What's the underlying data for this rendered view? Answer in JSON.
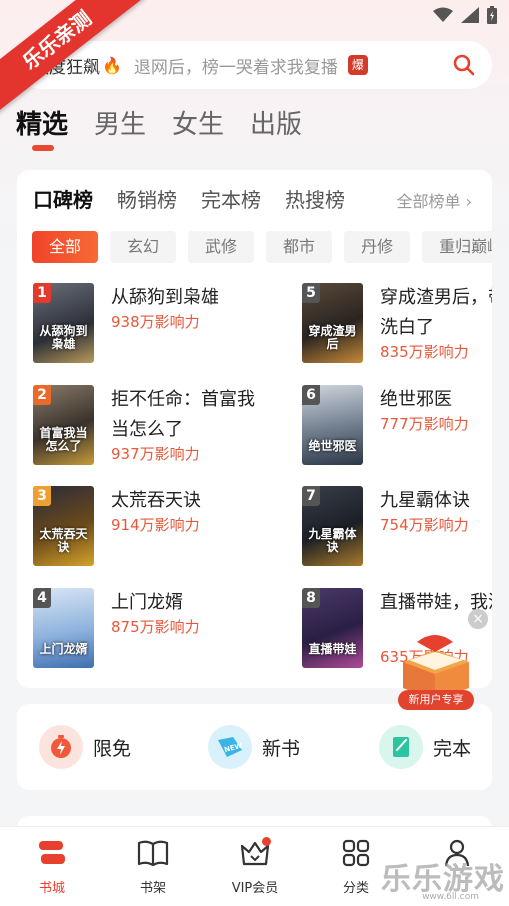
{
  "status_bar": {
    "icons": [
      "notification-icon",
      "a-icon",
      "wifi-icon",
      "signal-icon",
      "battery-icon"
    ]
  },
  "ribbon": {
    "text": "乐乐亲测"
  },
  "search": {
    "hot_label": "热度狂飙",
    "placeholder": "退网后，榜一哭着求我复播",
    "badge": "爆"
  },
  "channel_tabs": [
    {
      "label": "精选",
      "active": true
    },
    {
      "label": "男生",
      "active": false
    },
    {
      "label": "女生",
      "active": false
    },
    {
      "label": "出版",
      "active": false
    }
  ],
  "ranking": {
    "tabs": [
      "口碑榜",
      "畅销榜",
      "完本榜",
      "热搜榜"
    ],
    "active_tab": "口碑榜",
    "all_link": "全部榜单 ›",
    "genres": [
      "全部",
      "玄幻",
      "武修",
      "都市",
      "丹修",
      "重归巅峰"
    ],
    "active_genre": "全部",
    "books": [
      {
        "rank": "1",
        "title": "从舔狗到枭雄",
        "score": "938万影响力",
        "cover_text": "从舔狗到枭雄"
      },
      {
        "rank": "2",
        "title": "拒不任命：首富我当怎么了",
        "score": "937万影响力",
        "cover_text": "首富我当怎么了"
      },
      {
        "rank": "3",
        "title": "太荒吞天诀",
        "score": "914万影响力",
        "cover_text": "太荒吞天诀"
      },
      {
        "rank": "4",
        "title": "上门龙婿",
        "score": "875万影响力",
        "cover_text": "上门龙婿"
      },
      {
        "rank": "5",
        "title": "穿成渣男后，带娃洗白了",
        "score": "835万影响力",
        "cover_text": "穿成渣男后"
      },
      {
        "rank": "6",
        "title": "绝世邪医",
        "score": "777万影响力",
        "cover_text": "绝世邪医"
      },
      {
        "rank": "7",
        "title": "九星霸体诀",
        "score": "754万影响力",
        "cover_text": "九星霸体诀"
      },
      {
        "rank": "8",
        "title": "直播带娃，我流了",
        "score": "635万影响力",
        "cover_text": "直播带娃"
      }
    ]
  },
  "new_user": {
    "label": "新用户专享",
    "close": "×"
  },
  "quick_entries": [
    {
      "label": "限免",
      "icon": "timer-icon"
    },
    {
      "label": "新书",
      "icon": "new-tag-icon"
    },
    {
      "label": "完本",
      "icon": "book-complete-icon"
    }
  ],
  "bottom_nav": [
    {
      "label": "书城",
      "icon": "bookstore-icon",
      "active": true
    },
    {
      "label": "书架",
      "icon": "bookshelf-icon",
      "active": false
    },
    {
      "label": "VIP会员",
      "icon": "vip-crown-icon",
      "active": false
    },
    {
      "label": "分类",
      "icon": "category-icon",
      "active": false
    },
    {
      "label": "我的",
      "icon": "profile-icon",
      "active": false
    }
  ],
  "watermark": {
    "text": "乐乐游戏",
    "sub": "www.6ll.com"
  },
  "colors": {
    "accent": "#e8402f",
    "score": "#e8583a",
    "background": "#f4f5f7"
  }
}
